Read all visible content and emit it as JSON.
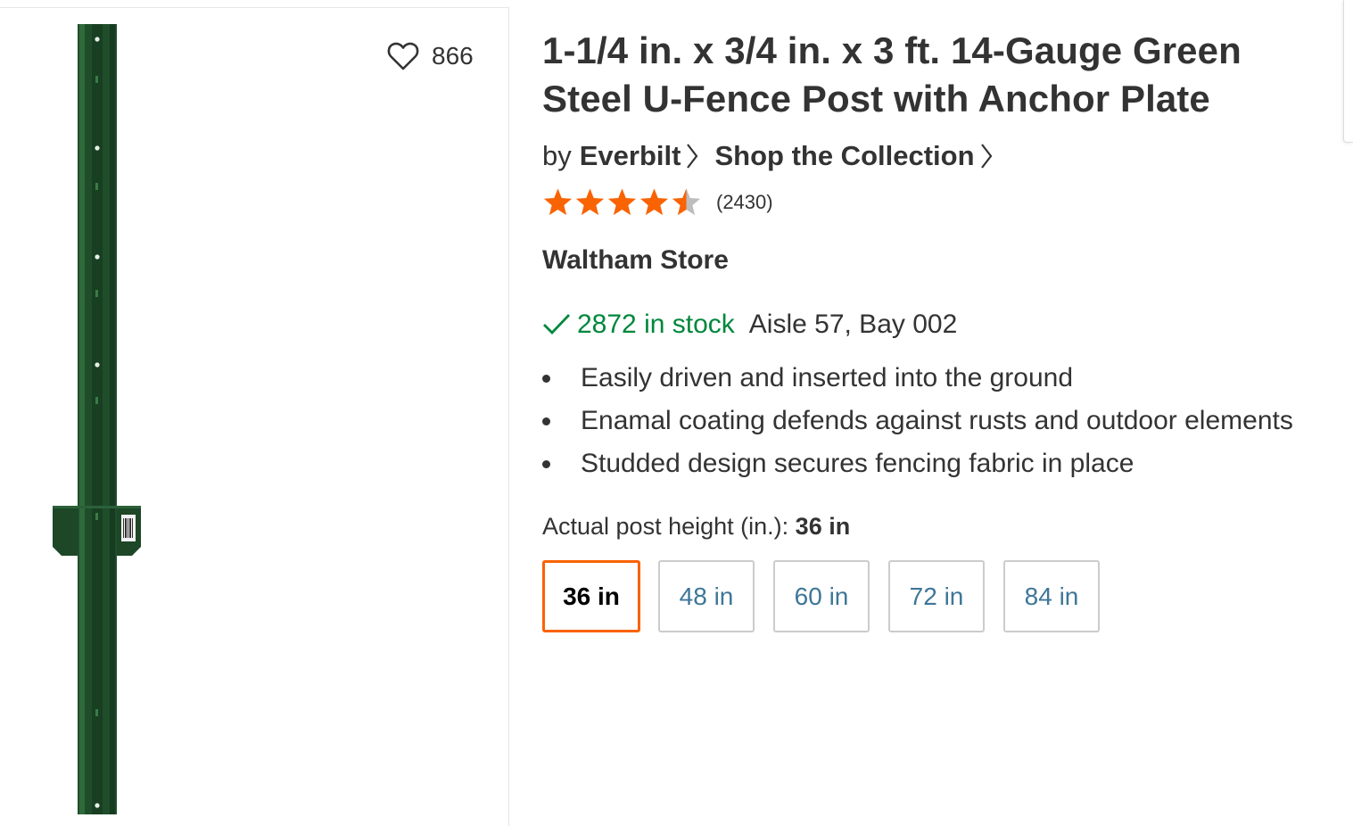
{
  "product": {
    "title_line1": "1-1/4 in. x 3/4 in. x 3 ft. 14-Gauge Green",
    "title_line2": "Steel U-Fence Post with Anchor Plate",
    "by_label": "by",
    "brand": "Everbilt",
    "collection_link": "Shop the Collection",
    "rating": 4.5,
    "review_count": "(2430)"
  },
  "favorites": {
    "count": "866",
    "icon": "heart-outline-icon"
  },
  "store": {
    "name": "Waltham Store",
    "stock": "2872 in stock",
    "aisle": "Aisle 57, Bay 002"
  },
  "bullets": [
    "Easily driven and inserted into the ground",
    "Enamal coating defends against rusts and outdoor elements",
    "Studded design secures fencing fabric in place"
  ],
  "variant": {
    "label": "Actual post height (in.):",
    "selected_value": "36 in",
    "options": [
      "36 in",
      "48 in",
      "60 in",
      "72 in",
      "84 in"
    ],
    "selected_index": 0
  },
  "colors": {
    "star": "#f96302",
    "star_empty": "#bdbdbd",
    "stock_green": "#00873c",
    "selected_border": "#f96302",
    "option_text": "#3e7697",
    "post_green": "#1f4d2a"
  }
}
